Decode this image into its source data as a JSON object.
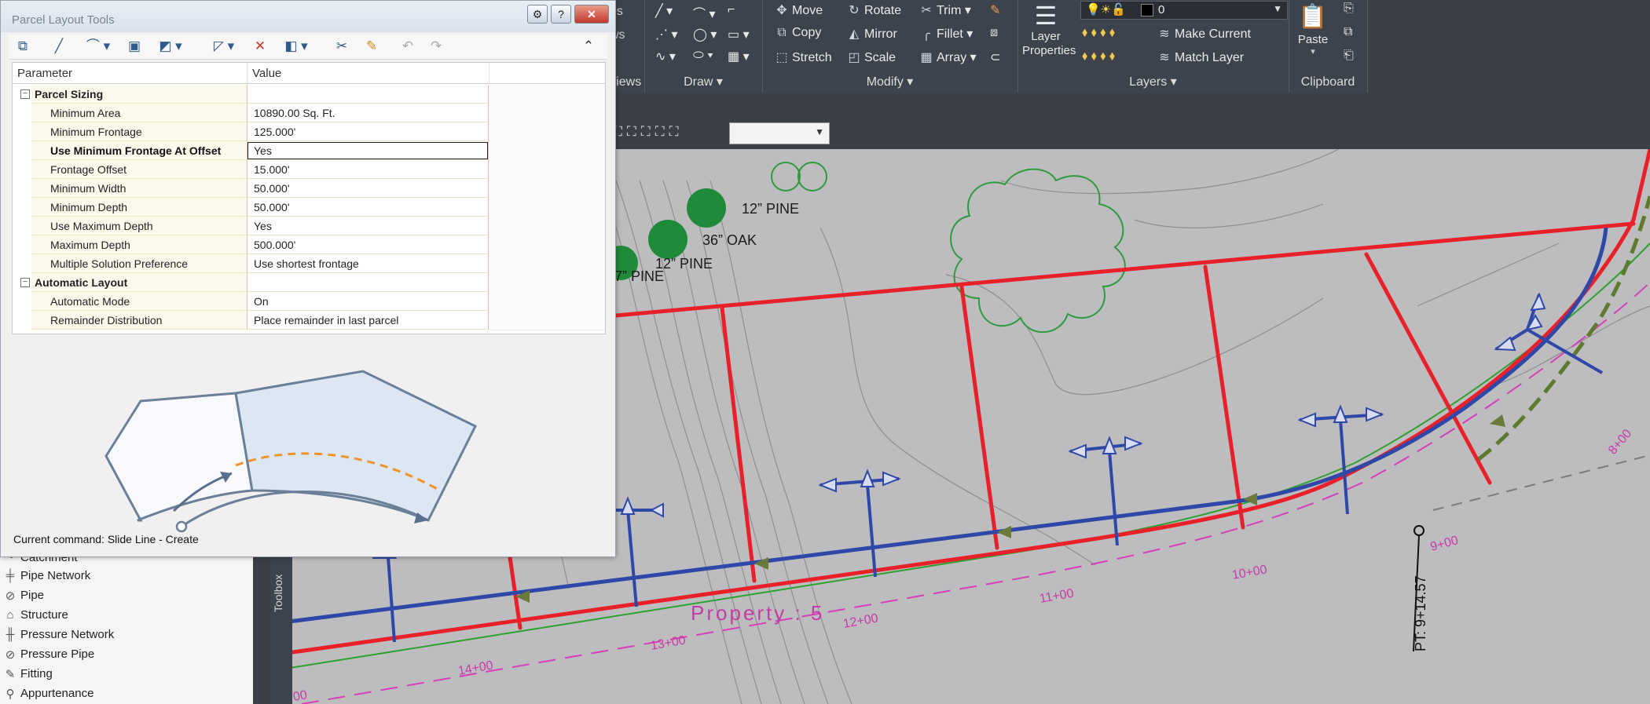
{
  "ribbon": {
    "views_label": "Views",
    "draw": {
      "title": "Draw"
    },
    "modify": {
      "title": "Modify",
      "move": "Move",
      "rotate": "Rotate",
      "trim": "Trim",
      "copy": "Copy",
      "mirror": "Mirror",
      "fillet": "Fillet",
      "stretch": "Stretch",
      "scale": "Scale",
      "array": "Array"
    },
    "layers": {
      "title": "Layers",
      "properties_line1": "Layer",
      "properties_line2": "Properties",
      "current_layer": "0",
      "make_current": "Make Current",
      "match_layer": "Match Layer"
    },
    "clipboard": {
      "title": "Clipboard",
      "paste": "Paste"
    }
  },
  "dialog": {
    "title": "Parcel Layout Tools",
    "columns": {
      "parameter": "Parameter",
      "value": "Value"
    },
    "categories": [
      {
        "name": "Parcel Sizing",
        "rows": [
          {
            "param": "Minimum Area",
            "value": "10890.00 Sq. Ft."
          },
          {
            "param": "Minimum Frontage",
            "value": "125.000'"
          },
          {
            "param": "Use Minimum Frontage At Offset",
            "value": "Yes"
          },
          {
            "param": "Frontage Offset",
            "value": "15.000'"
          },
          {
            "param": "Minimum Width",
            "value": "50.000'"
          },
          {
            "param": "Minimum Depth",
            "value": "50.000'"
          },
          {
            "param": "Use Maximum Depth",
            "value": "Yes"
          },
          {
            "param": "Maximum Depth",
            "value": "500.000'"
          },
          {
            "param": "Multiple Solution Preference",
            "value": "Use shortest frontage"
          }
        ]
      },
      {
        "name": "Automatic Layout",
        "rows": [
          {
            "param": "Automatic Mode",
            "value": "On"
          },
          {
            "param": "Remainder Distribution",
            "value": "Place remainder in last parcel"
          }
        ]
      }
    ],
    "status": "Current command: Slide Line - Create"
  },
  "toolbox": {
    "label": "Toolbox",
    "items": [
      {
        "label": "Catchment",
        "icon": "catchment-icon"
      },
      {
        "label": "Pipe Network",
        "icon": "pipe-network-icon"
      },
      {
        "label": "Pipe",
        "icon": "pipe-icon"
      },
      {
        "label": "Structure",
        "icon": "structure-icon"
      },
      {
        "label": "Pressure Network",
        "icon": "pressure-network-icon"
      },
      {
        "label": "Pressure Pipe",
        "icon": "pressure-pipe-icon"
      },
      {
        "label": "Fitting",
        "icon": "fitting-icon"
      },
      {
        "label": "Appurtenance",
        "icon": "appurtenance-icon"
      }
    ]
  },
  "drawing": {
    "property_label": "Property : 5",
    "point_label": "PT: 9+14.57",
    "trees": [
      {
        "label": "12” PINE"
      },
      {
        "label": "36” OAK"
      },
      {
        "label": "12” PINE"
      },
      {
        "label": "7” PINE"
      }
    ],
    "stations": [
      "8+00",
      "9+00",
      "10+00",
      "11+00",
      "12+00",
      "13+00",
      "14+00",
      "00"
    ]
  },
  "colors": {
    "parcel_lines": "#e8202a",
    "alignment": "#2f48a8",
    "frontage_arrows": "#2f48a8",
    "offset_line": "#d63fb7",
    "green_line": "#2fa02f",
    "canvas": "#bdbdbf"
  }
}
